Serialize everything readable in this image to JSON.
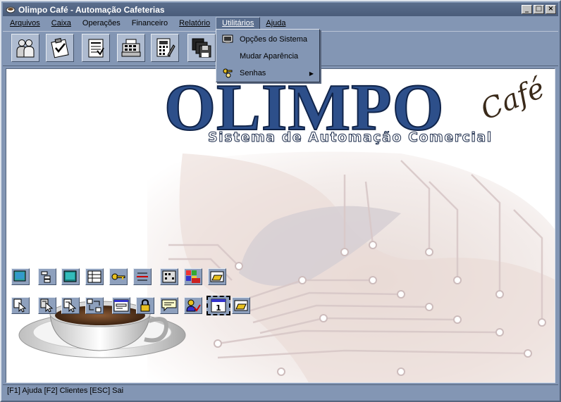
{
  "window": {
    "title": "Olimpo Café - Automação Cafeterias",
    "controls": [
      "_",
      "□",
      "×"
    ]
  },
  "menubar": {
    "items": [
      {
        "label": "Arquivos",
        "icon": "none"
      },
      {
        "label": "Caixa",
        "icon": "none"
      },
      {
        "label": "Operações",
        "icon": "none"
      },
      {
        "label": "Financeiro",
        "icon": "none"
      },
      {
        "label": "Relatório",
        "icon": "none"
      },
      {
        "label": "Utilitários",
        "icon": "none",
        "active": true
      },
      {
        "label": "Ajuda",
        "icon": "none"
      }
    ]
  },
  "toolbar": {
    "buttons": [
      {
        "icon": "clients-icon"
      },
      {
        "icon": "checklist-icon"
      },
      {
        "icon": "document-icon"
      },
      {
        "icon": "cash-register-icon"
      },
      {
        "icon": "calculator-icon"
      },
      {
        "icon": "floppy-disks-icon"
      }
    ]
  },
  "dropdown": {
    "items": [
      {
        "label": "Opções do Sistema",
        "icon": "monitor-icon"
      },
      {
        "label": "Mudar Aparência",
        "icon": "none"
      },
      {
        "label": "Senhas",
        "icon": "keys-icon",
        "submenu": true
      }
    ]
  },
  "logo": {
    "word": "OLIMPO",
    "script": "Café",
    "subtitle": "Sistema de Automação Comercial"
  },
  "status": {
    "text": "[F1] Ajuda  [F2] Clientes  [ESC] Sai"
  },
  "colors": {
    "window_bg": "#8396b4",
    "title_bg": "#4a5c7a",
    "logo_blue": "#2d4f8a"
  }
}
